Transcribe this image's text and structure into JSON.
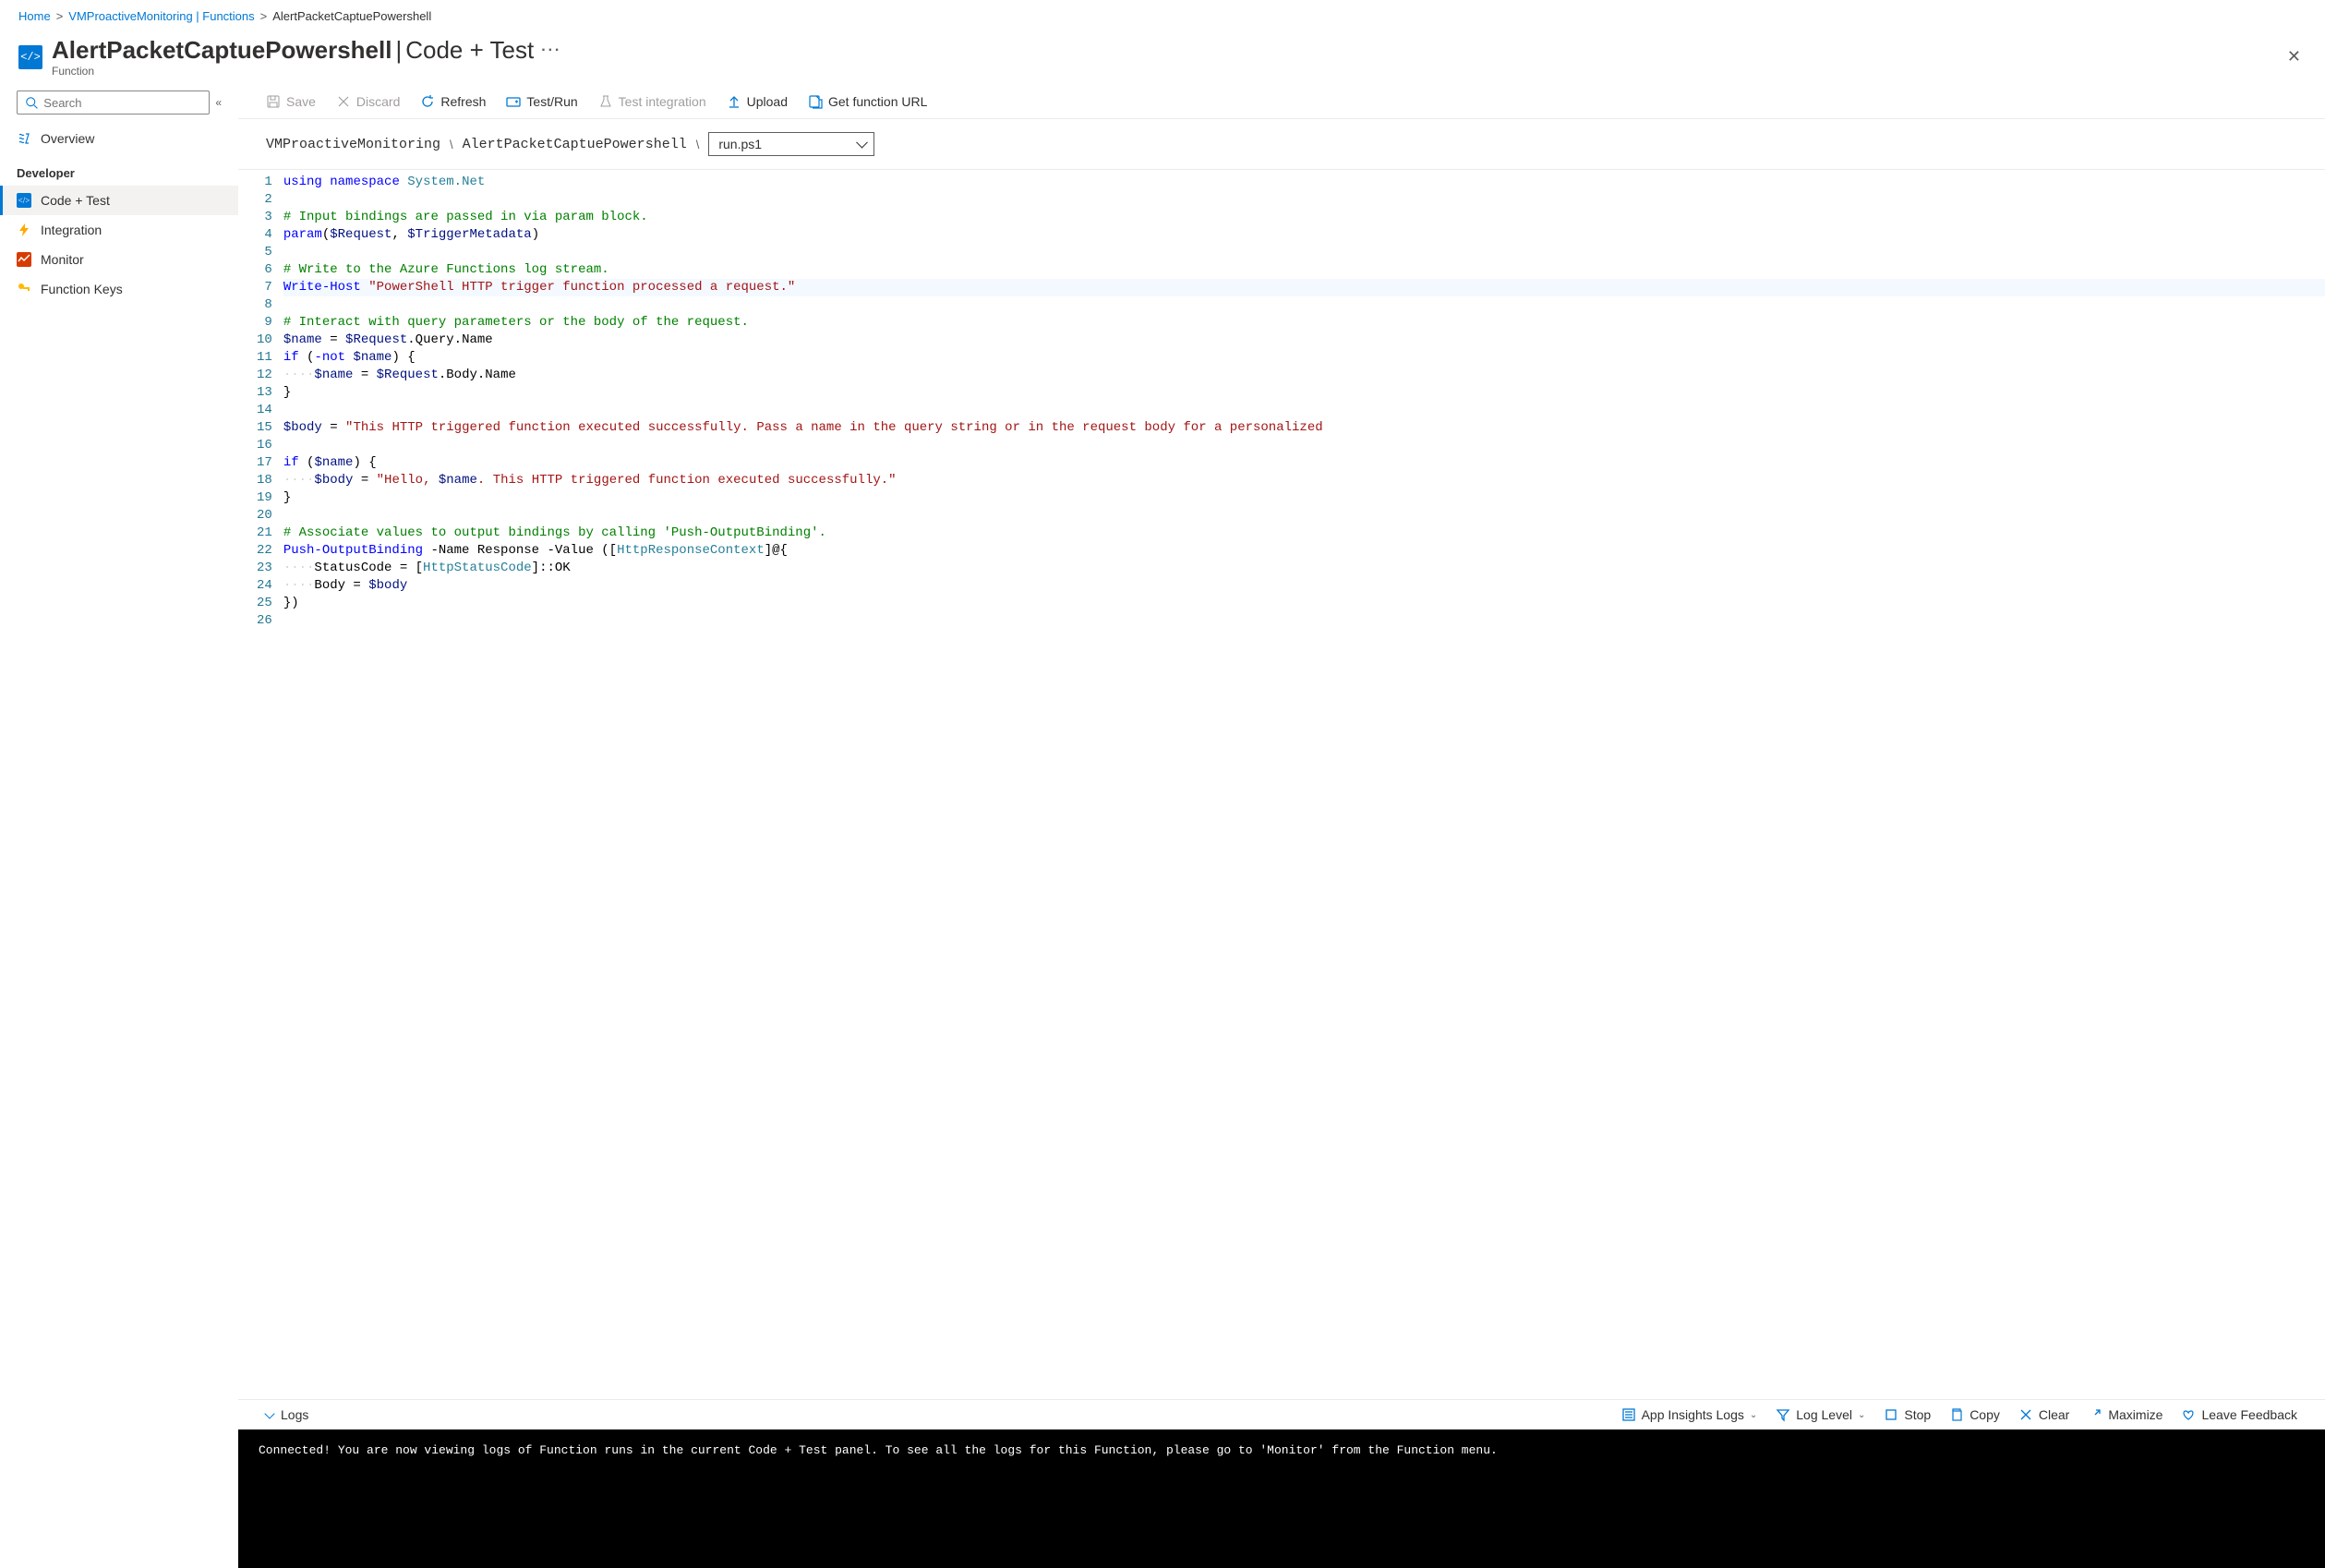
{
  "breadcrumb": {
    "home": "Home",
    "mid": "VMProactiveMonitoring | Functions",
    "current": "AlertPacketCaptuePowershell"
  },
  "header": {
    "title_main": "AlertPacketCaptuePowershell",
    "title_sep": " | ",
    "title_sub": "Code + Test",
    "subtitle": "Function"
  },
  "sidebar": {
    "search_placeholder": "Search",
    "overview": "Overview",
    "section": "Developer",
    "items": {
      "code": "Code + Test",
      "integration": "Integration",
      "monitor": "Monitor",
      "keys": "Function Keys"
    }
  },
  "toolbar": {
    "save": "Save",
    "discard": "Discard",
    "refresh": "Refresh",
    "testrun": "Test/Run",
    "testint": "Test integration",
    "upload": "Upload",
    "geturl": "Get function URL"
  },
  "path": {
    "root": "VMProactiveMonitoring",
    "func": "AlertPacketCaptuePowershell",
    "file": "run.ps1"
  },
  "code": {
    "lines": [
      {
        "n": 1,
        "h": [
          [
            "tok-k",
            "using"
          ],
          [
            "tok-p",
            " "
          ],
          [
            "tok-k",
            "namespace"
          ],
          [
            "tok-p",
            " "
          ],
          [
            "tok-ns",
            "System.Net"
          ]
        ]
      },
      {
        "n": 2,
        "h": []
      },
      {
        "n": 3,
        "h": [
          [
            "tok-c",
            "# Input bindings are passed in via param block."
          ]
        ]
      },
      {
        "n": 4,
        "h": [
          [
            "tok-k",
            "param"
          ],
          [
            "tok-p",
            "("
          ],
          [
            "tok-v",
            "$Request"
          ],
          [
            "tok-p",
            ", "
          ],
          [
            "tok-v",
            "$TriggerMetadata"
          ],
          [
            "tok-p",
            ")"
          ]
        ]
      },
      {
        "n": 5,
        "h": []
      },
      {
        "n": 6,
        "h": [
          [
            "tok-c",
            "# Write to the Azure Functions log stream."
          ]
        ]
      },
      {
        "n": 7,
        "hl": true,
        "h": [
          [
            "tok-k",
            "Write-Host"
          ],
          [
            "tok-p",
            " "
          ],
          [
            "tok-s",
            "\"PowerShell HTTP trigger function processed a request.\""
          ]
        ]
      },
      {
        "n": 8,
        "h": []
      },
      {
        "n": 9,
        "h": [
          [
            "tok-c",
            "# Interact with query parameters or the body of the request."
          ]
        ]
      },
      {
        "n": 10,
        "h": [
          [
            "tok-v",
            "$name"
          ],
          [
            "tok-p",
            " = "
          ],
          [
            "tok-v",
            "$Request"
          ],
          [
            "tok-p",
            ".Query.Name"
          ]
        ]
      },
      {
        "n": 11,
        "h": [
          [
            "tok-k",
            "if"
          ],
          [
            "tok-p",
            " ("
          ],
          [
            "tok-k",
            "-not"
          ],
          [
            "tok-p",
            " "
          ],
          [
            "tok-v",
            "$name"
          ],
          [
            "tok-p",
            ") {"
          ]
        ]
      },
      {
        "n": 12,
        "h": [
          [
            "dot",
            "····"
          ],
          [
            "tok-v",
            "$name"
          ],
          [
            "tok-p",
            " = "
          ],
          [
            "tok-v",
            "$Request"
          ],
          [
            "tok-p",
            ".Body.Name"
          ]
        ]
      },
      {
        "n": 13,
        "h": [
          [
            "tok-p",
            "}"
          ]
        ]
      },
      {
        "n": 14,
        "h": []
      },
      {
        "n": 15,
        "h": [
          [
            "tok-v",
            "$body"
          ],
          [
            "tok-p",
            " = "
          ],
          [
            "tok-s",
            "\"This HTTP triggered function executed successfully. Pass a name in the query string or in the request body for a personalized"
          ]
        ]
      },
      {
        "n": 16,
        "h": []
      },
      {
        "n": 17,
        "h": [
          [
            "tok-k",
            "if"
          ],
          [
            "tok-p",
            " ("
          ],
          [
            "tok-v",
            "$name"
          ],
          [
            "tok-p",
            ") {"
          ]
        ]
      },
      {
        "n": 18,
        "h": [
          [
            "dot",
            "····"
          ],
          [
            "tok-v",
            "$body"
          ],
          [
            "tok-p",
            " = "
          ],
          [
            "tok-s",
            "\"Hello, "
          ],
          [
            "tok-v",
            "$name"
          ],
          [
            "tok-s",
            ". This HTTP triggered function executed successfully.\""
          ]
        ]
      },
      {
        "n": 19,
        "h": [
          [
            "tok-p",
            "}"
          ]
        ]
      },
      {
        "n": 20,
        "h": []
      },
      {
        "n": 21,
        "h": [
          [
            "tok-c",
            "# Associate values to output bindings by calling 'Push-OutputBinding'."
          ]
        ]
      },
      {
        "n": 22,
        "h": [
          [
            "tok-k",
            "Push-OutputBinding"
          ],
          [
            "tok-p",
            " -Name Response -Value (["
          ],
          [
            "tok-ns",
            "HttpResponseContext"
          ],
          [
            "tok-p",
            "]@{"
          ]
        ]
      },
      {
        "n": 23,
        "h": [
          [
            "dot",
            "····"
          ],
          [
            "tok-p",
            "StatusCode = ["
          ],
          [
            "tok-ns",
            "HttpStatusCode"
          ],
          [
            "tok-p",
            "]::OK"
          ]
        ]
      },
      {
        "n": 24,
        "h": [
          [
            "dot",
            "····"
          ],
          [
            "tok-p",
            "Body = "
          ],
          [
            "tok-v",
            "$body"
          ]
        ]
      },
      {
        "n": 25,
        "h": [
          [
            "tok-p",
            "})"
          ]
        ]
      },
      {
        "n": 26,
        "h": []
      }
    ]
  },
  "logs": {
    "label": "Logs",
    "appinsights": "App Insights Logs",
    "loglevel": "Log Level",
    "stop": "Stop",
    "copy": "Copy",
    "clear": "Clear",
    "maximize": "Maximize",
    "feedback": "Leave Feedback",
    "terminal": "Connected! You are now viewing logs of Function runs in the current Code + Test panel. To see all the logs for this Function, please go to 'Monitor' from the Function menu."
  }
}
